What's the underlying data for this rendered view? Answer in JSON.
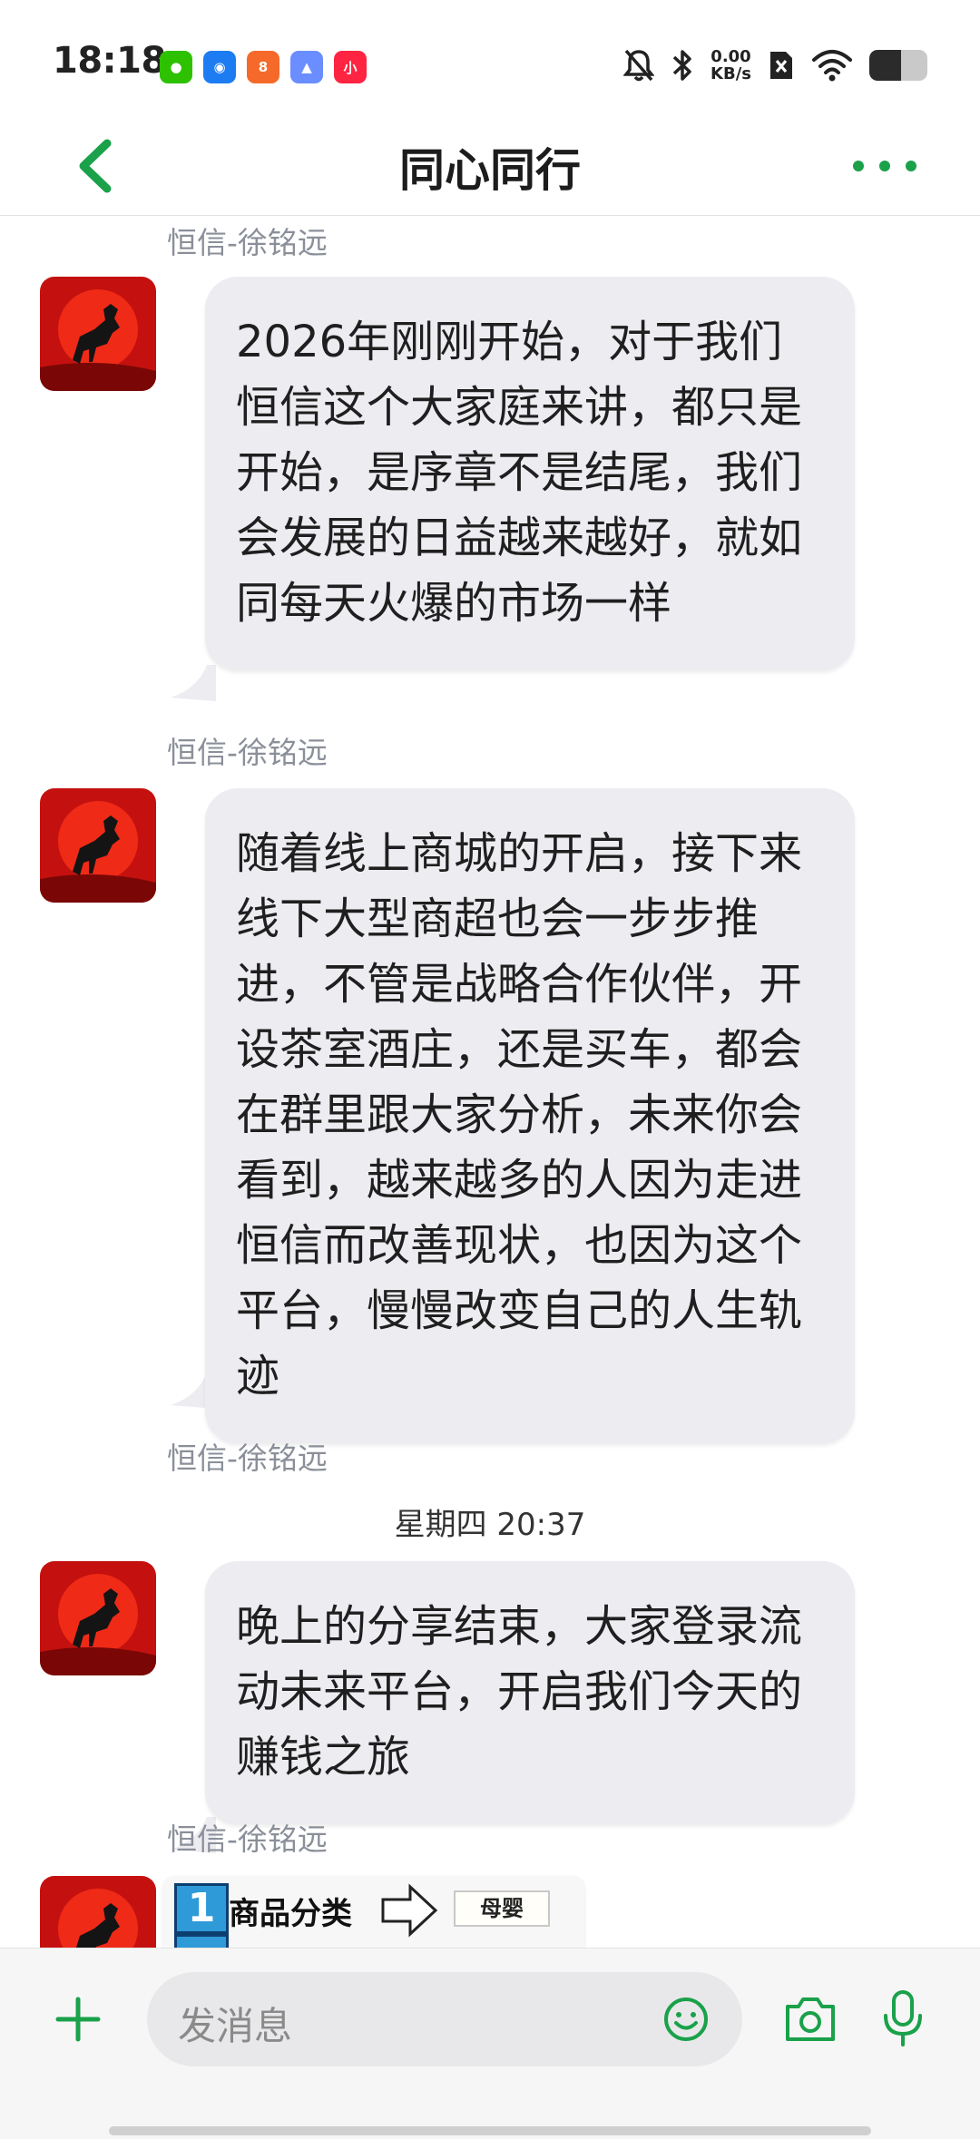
{
  "status_bar": {
    "time": "18:18",
    "net_speed_value": "0.00",
    "net_speed_unit": "KB/s",
    "battery_level": 0.55,
    "app_icons": [
      {
        "name": "wechat-icon",
        "color": "#2dc100",
        "glyph": "●"
      },
      {
        "name": "browser-icon",
        "color": "#1e7cf2",
        "glyph": "◉"
      },
      {
        "name": "app-88-icon",
        "color": "#f56a2a",
        "glyph": "8"
      },
      {
        "name": "gallery-icon",
        "color": "#6a8dff",
        "glyph": "▲"
      },
      {
        "name": "xiaohongshu-icon",
        "color": "#ff2442",
        "glyph": "小"
      }
    ]
  },
  "nav": {
    "title": "同心同行"
  },
  "colors": {
    "accent": "#1aa14a",
    "bubble": "#ececf1",
    "sender": "#8a8f99"
  },
  "chat": {
    "top_sender": "恒信-徐铭远",
    "messages": [
      {
        "text": "2026年刚刚开始，对于我们恒信这个大家庭来讲，都只是开始，是序章不是结尾，我们会发展的日益越来越好，就如同每天火爆的市场一样",
        "sender": "恒信-徐铭远"
      },
      {
        "text": "随着线上商城的开启，接下来线下大型商超也会一步步推进，不管是战略合作伙伴，开设茶室酒庄，还是买车，都会在群里跟大家分析，未来你会看到，越来越多的人因为走进恒信而改善现状，也因为这个平台，慢慢改变自己的人生轨迹",
        "sender": "恒信-徐铭远"
      }
    ],
    "timestamp": "星期四 20:37",
    "messages_after": [
      {
        "text": "晚上的分享结束，大家登录流动未来平台，开启我们今天的赚钱之旅",
        "sender": "恒信-徐铭远"
      }
    ],
    "image_message": {
      "number": "1",
      "category_label": "商品分类",
      "tag": "母婴"
    }
  },
  "input": {
    "placeholder": "发消息"
  }
}
